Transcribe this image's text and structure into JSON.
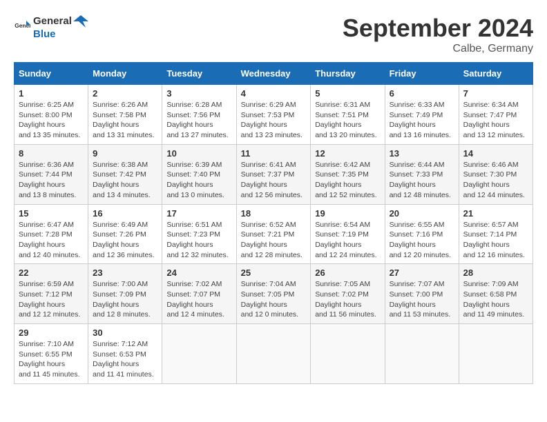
{
  "header": {
    "logo_text_general": "General",
    "logo_text_blue": "Blue",
    "month_title": "September 2024",
    "location": "Calbe, Germany"
  },
  "days_of_week": [
    "Sunday",
    "Monday",
    "Tuesday",
    "Wednesday",
    "Thursday",
    "Friday",
    "Saturday"
  ],
  "weeks": [
    [
      {
        "day": "1",
        "sunrise": "6:25 AM",
        "sunset": "8:00 PM",
        "daylight": "13 hours and 35 minutes."
      },
      {
        "day": "2",
        "sunrise": "6:26 AM",
        "sunset": "7:58 PM",
        "daylight": "13 hours and 31 minutes."
      },
      {
        "day": "3",
        "sunrise": "6:28 AM",
        "sunset": "7:56 PM",
        "daylight": "13 hours and 27 minutes."
      },
      {
        "day": "4",
        "sunrise": "6:29 AM",
        "sunset": "7:53 PM",
        "daylight": "13 hours and 23 minutes."
      },
      {
        "day": "5",
        "sunrise": "6:31 AM",
        "sunset": "7:51 PM",
        "daylight": "13 hours and 20 minutes."
      },
      {
        "day": "6",
        "sunrise": "6:33 AM",
        "sunset": "7:49 PM",
        "daylight": "13 hours and 16 minutes."
      },
      {
        "day": "7",
        "sunrise": "6:34 AM",
        "sunset": "7:47 PM",
        "daylight": "13 hours and 12 minutes."
      }
    ],
    [
      {
        "day": "8",
        "sunrise": "6:36 AM",
        "sunset": "7:44 PM",
        "daylight": "13 hours and 8 minutes."
      },
      {
        "day": "9",
        "sunrise": "6:38 AM",
        "sunset": "7:42 PM",
        "daylight": "13 hours and 4 minutes."
      },
      {
        "day": "10",
        "sunrise": "6:39 AM",
        "sunset": "7:40 PM",
        "daylight": "13 hours and 0 minutes."
      },
      {
        "day": "11",
        "sunrise": "6:41 AM",
        "sunset": "7:37 PM",
        "daylight": "12 hours and 56 minutes."
      },
      {
        "day": "12",
        "sunrise": "6:42 AM",
        "sunset": "7:35 PM",
        "daylight": "12 hours and 52 minutes."
      },
      {
        "day": "13",
        "sunrise": "6:44 AM",
        "sunset": "7:33 PM",
        "daylight": "12 hours and 48 minutes."
      },
      {
        "day": "14",
        "sunrise": "6:46 AM",
        "sunset": "7:30 PM",
        "daylight": "12 hours and 44 minutes."
      }
    ],
    [
      {
        "day": "15",
        "sunrise": "6:47 AM",
        "sunset": "7:28 PM",
        "daylight": "12 hours and 40 minutes."
      },
      {
        "day": "16",
        "sunrise": "6:49 AM",
        "sunset": "7:26 PM",
        "daylight": "12 hours and 36 minutes."
      },
      {
        "day": "17",
        "sunrise": "6:51 AM",
        "sunset": "7:23 PM",
        "daylight": "12 hours and 32 minutes."
      },
      {
        "day": "18",
        "sunrise": "6:52 AM",
        "sunset": "7:21 PM",
        "daylight": "12 hours and 28 minutes."
      },
      {
        "day": "19",
        "sunrise": "6:54 AM",
        "sunset": "7:19 PM",
        "daylight": "12 hours and 24 minutes."
      },
      {
        "day": "20",
        "sunrise": "6:55 AM",
        "sunset": "7:16 PM",
        "daylight": "12 hours and 20 minutes."
      },
      {
        "day": "21",
        "sunrise": "6:57 AM",
        "sunset": "7:14 PM",
        "daylight": "12 hours and 16 minutes."
      }
    ],
    [
      {
        "day": "22",
        "sunrise": "6:59 AM",
        "sunset": "7:12 PM",
        "daylight": "12 hours and 12 minutes."
      },
      {
        "day": "23",
        "sunrise": "7:00 AM",
        "sunset": "7:09 PM",
        "daylight": "12 hours and 8 minutes."
      },
      {
        "day": "24",
        "sunrise": "7:02 AM",
        "sunset": "7:07 PM",
        "daylight": "12 hours and 4 minutes."
      },
      {
        "day": "25",
        "sunrise": "7:04 AM",
        "sunset": "7:05 PM",
        "daylight": "12 hours and 0 minutes."
      },
      {
        "day": "26",
        "sunrise": "7:05 AM",
        "sunset": "7:02 PM",
        "daylight": "11 hours and 56 minutes."
      },
      {
        "day": "27",
        "sunrise": "7:07 AM",
        "sunset": "7:00 PM",
        "daylight": "11 hours and 53 minutes."
      },
      {
        "day": "28",
        "sunrise": "7:09 AM",
        "sunset": "6:58 PM",
        "daylight": "11 hours and 49 minutes."
      }
    ],
    [
      {
        "day": "29",
        "sunrise": "7:10 AM",
        "sunset": "6:55 PM",
        "daylight": "11 hours and 45 minutes."
      },
      {
        "day": "30",
        "sunrise": "7:12 AM",
        "sunset": "6:53 PM",
        "daylight": "11 hours and 41 minutes."
      },
      null,
      null,
      null,
      null,
      null
    ]
  ]
}
